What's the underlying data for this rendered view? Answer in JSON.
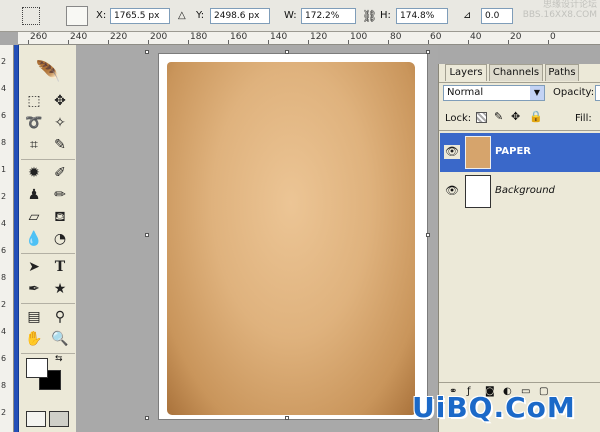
{
  "options_bar": {
    "x_label": "X:",
    "x_value": "1765.5 px",
    "y_label": "Y:",
    "y_value": "2498.6 px",
    "w_label": "W:",
    "w_value": "172.2%",
    "h_label": "H:",
    "h_value": "174.8%",
    "angle_value": "0.0",
    "watermark_top": "思缘设计论坛",
    "watermark_url": "BBS.16XX8.COM"
  },
  "ruler": {
    "ticks": [
      "260",
      "240",
      "220",
      "200",
      "180",
      "160",
      "140",
      "120",
      "100",
      "80",
      "60",
      "40",
      "20",
      "0"
    ]
  },
  "vruler": {
    "ticks": [
      "2",
      "4",
      "6",
      "8",
      "1",
      "2",
      "4",
      "6",
      "8",
      "2",
      "4",
      "6",
      "8",
      "2"
    ]
  },
  "layers_panel": {
    "tabs": [
      "Layers",
      "Channels",
      "Paths"
    ],
    "blend_mode": "Normal",
    "opacity_label": "Opacity:",
    "lock_label": "Lock:",
    "fill_label": "Fill:",
    "layers": [
      {
        "name": "PAPER",
        "selected": true
      },
      {
        "name": "Background",
        "selected": false
      }
    ]
  },
  "watermark": {
    "text": "UiBQ.CoM"
  },
  "colors": {
    "accent": "#3a68c9",
    "paper": "#dfb27d",
    "panel": "#ece9d8"
  }
}
